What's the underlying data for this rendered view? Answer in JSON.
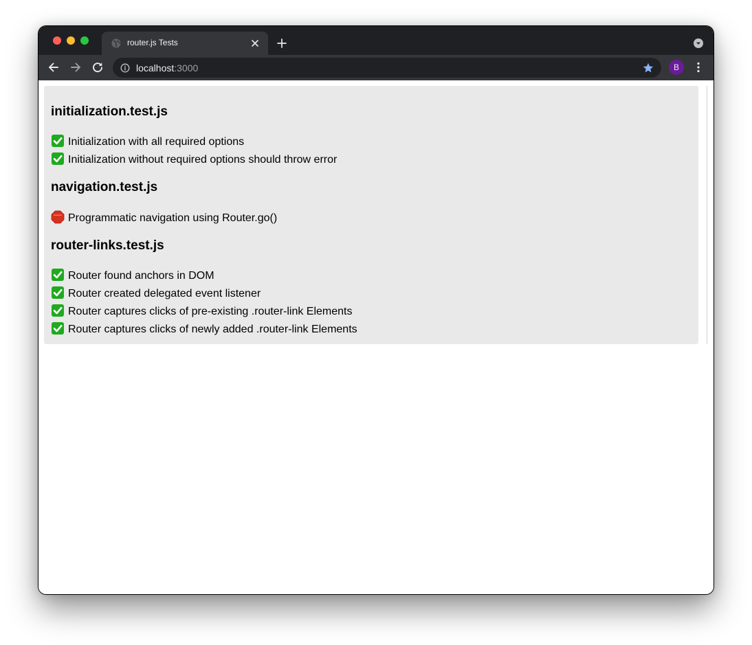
{
  "browser": {
    "tab_title": "router.js Tests",
    "url_host": "localhost",
    "url_port": ":3000",
    "profile_initial": "B",
    "accent_color": "#8ab4f8",
    "profile_color": "#6a1b9a"
  },
  "icons": {
    "tab_favicon": "globe-icon",
    "tab_close": "close-icon",
    "new_tab": "plus-icon",
    "back": "arrow-left-icon",
    "forward": "arrow-right-icon",
    "reload": "reload-icon",
    "site_info": "info-icon",
    "bookmark": "star-icon",
    "menu": "kebab-menu-icon",
    "tab_search": "chevron-down-circle-icon",
    "pass": "white-check-mark-emoji",
    "fail": "stop-sign-emoji"
  },
  "status_colors": {
    "pass": "#1faa1f",
    "fail": "#d8301f"
  },
  "suites": [
    {
      "title": "initialization.test.js",
      "tests": [
        {
          "status": "pass",
          "label": "Initialization with all required options"
        },
        {
          "status": "pass",
          "label": "Initialization without required options should throw error"
        }
      ]
    },
    {
      "title": "navigation.test.js",
      "tests": [
        {
          "status": "fail",
          "label": "Programmatic navigation using Router.go()"
        }
      ]
    },
    {
      "title": "router-links.test.js",
      "tests": [
        {
          "status": "pass",
          "label": "Router found anchors in DOM"
        },
        {
          "status": "pass",
          "label": "Router created delegated event listener"
        },
        {
          "status": "pass",
          "label": "Router captures clicks of pre-existing .router-link Elements"
        },
        {
          "status": "pass",
          "label": "Router captures clicks of newly added .router-link Elements"
        }
      ]
    }
  ]
}
